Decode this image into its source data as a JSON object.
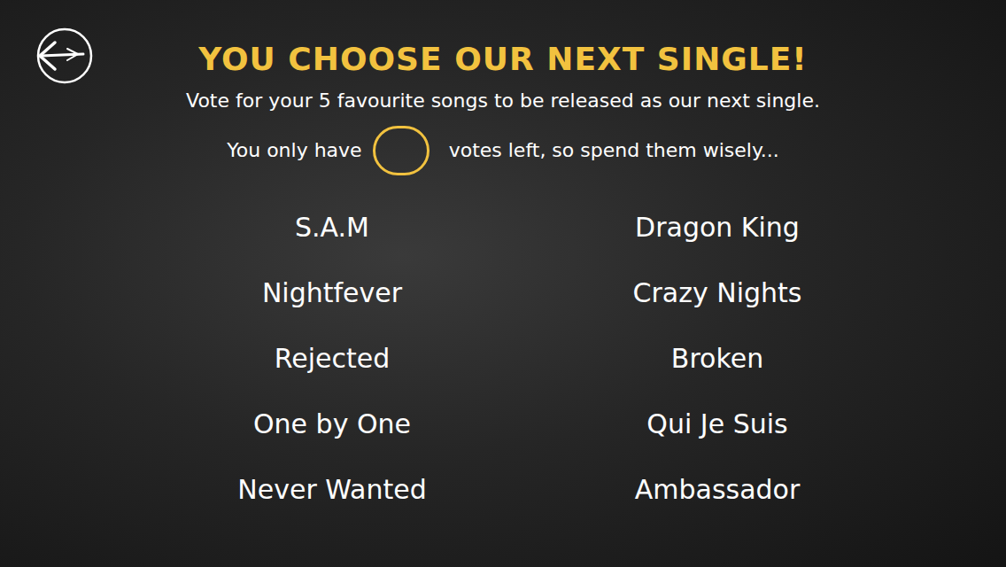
{
  "header": {
    "title": "YOU CHOOSE OUR NEXT SINGLE!",
    "subtitle": "Vote for your 5 favourite songs to be released as our next single.",
    "votes_before": "You only have",
    "votes_after": "votes left, so spend them wisely..."
  },
  "songs": {
    "left": [
      "S.A.M",
      "Nightfever",
      "Rejected",
      "One by One",
      "Never Wanted"
    ],
    "right": [
      "Dragon King",
      "Crazy Nights",
      "Broken",
      "Qui Je Suis",
      "Ambassador"
    ]
  }
}
